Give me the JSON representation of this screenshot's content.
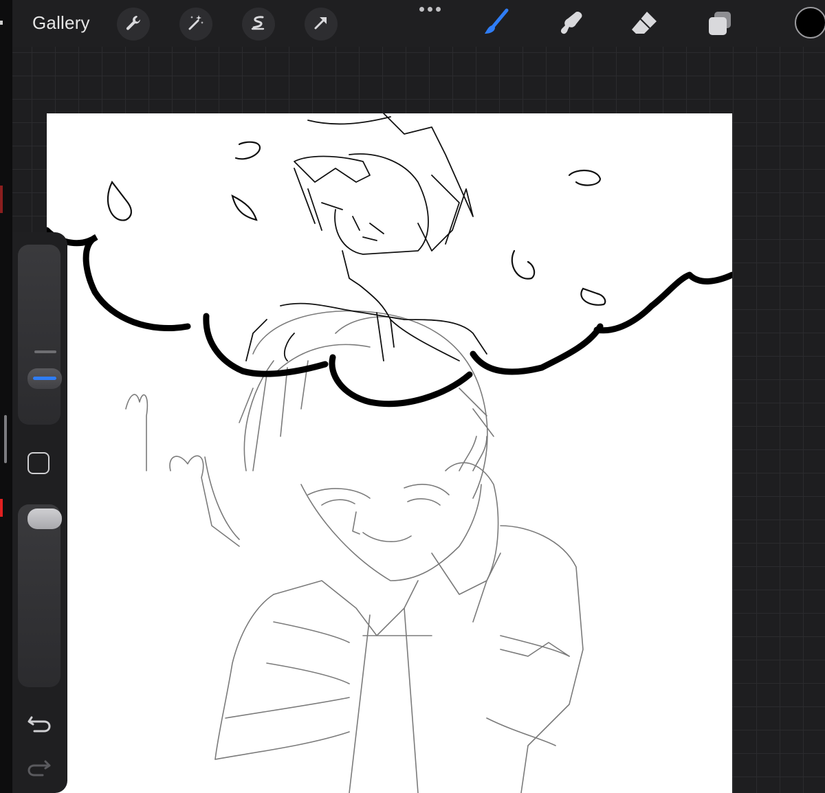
{
  "toolbar": {
    "gallery_label": "Gallery",
    "left_tools": [
      "wrench-icon",
      "magic-wand-icon",
      "selection-icon",
      "transform-arrow-icon"
    ],
    "right_tools": [
      "brush-icon",
      "smudge-icon",
      "eraser-icon",
      "layers-icon"
    ],
    "active_tool": "brush-icon",
    "current_color": "#000000"
  },
  "sidebar": {
    "brush_size_fraction": 0.18,
    "opacity_fraction": 0.05,
    "undo_icon": "undo-icon",
    "redo_icon": "redo-icon"
  },
  "colors": {
    "accent": "#2f7df6",
    "toolbar_bg": "#1f1f21",
    "canvas_bg": "#ffffff"
  }
}
